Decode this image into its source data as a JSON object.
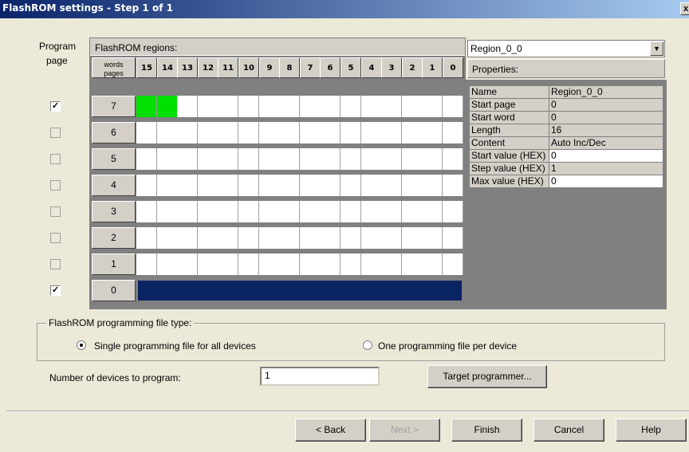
{
  "window": {
    "title": "FlashROM settings - Step 1 of 1",
    "close_label": "x"
  },
  "left": {
    "program_label": "Program",
    "page_label": "page"
  },
  "grid": {
    "header_label": "FlashROM regions:",
    "corner_top": "words",
    "corner_bottom": "pages",
    "word_columns": [
      "15",
      "14",
      "13",
      "12",
      "11",
      "10",
      "9",
      "8",
      "7",
      "6",
      "5",
      "4",
      "3",
      "2",
      "1",
      "0"
    ],
    "pages": [
      {
        "label": "7",
        "checked": true,
        "filled_words": [
          "15",
          "14"
        ],
        "full_region": false
      },
      {
        "label": "6",
        "checked": false,
        "filled_words": [],
        "full_region": false
      },
      {
        "label": "5",
        "checked": false,
        "filled_words": [],
        "full_region": false
      },
      {
        "label": "4",
        "checked": false,
        "filled_words": [],
        "full_region": false
      },
      {
        "label": "3",
        "checked": false,
        "filled_words": [],
        "full_region": false
      },
      {
        "label": "2",
        "checked": false,
        "filled_words": [],
        "full_region": false
      },
      {
        "label": "1",
        "checked": false,
        "filled_words": [],
        "full_region": false
      },
      {
        "label": "0",
        "checked": true,
        "filled_words": [],
        "full_region": true
      }
    ],
    "colors": {
      "selected_word": "#00e000",
      "full_region": "#0a2463"
    }
  },
  "region_select": {
    "value": "Region_0_0"
  },
  "properties": {
    "header": "Properties:",
    "rows": [
      {
        "key": "Name",
        "value": "Region_0_0",
        "editable": false
      },
      {
        "key": "Start page",
        "value": "0",
        "editable": false
      },
      {
        "key": "Start word",
        "value": "0",
        "editable": false
      },
      {
        "key": "Length",
        "value": "16",
        "editable": false
      },
      {
        "key": "Content",
        "value": "Auto Inc/Dec",
        "editable": false
      },
      {
        "key": "Start value (HEX)",
        "value": "0",
        "editable": true
      },
      {
        "key": "Step value (HEX)",
        "value": "1",
        "editable": false
      },
      {
        "key": "Max value (HEX)",
        "value": "0",
        "editable": true
      }
    ]
  },
  "file_type": {
    "group_label": "FlashROM programming file type:",
    "option_single": "Single programming file for all devices",
    "option_per_device": "One programming file per device",
    "selected": "single"
  },
  "devices": {
    "label": "Number of devices to program:",
    "value": "1"
  },
  "buttons": {
    "target_programmer": "Target programmer...",
    "back": "< Back",
    "next": "Next >",
    "finish": "Finish",
    "cancel": "Cancel",
    "help": "Help"
  }
}
